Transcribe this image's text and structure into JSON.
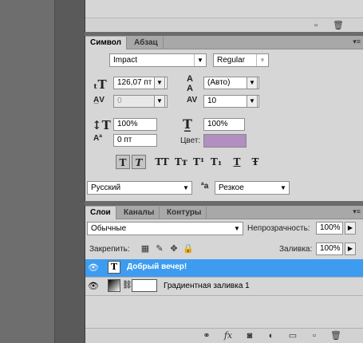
{
  "char_panel": {
    "tabs": [
      "Символ",
      "Абзац"
    ],
    "font_family": "Impact",
    "font_style": "Regular",
    "font_size": "126,07 пт",
    "leading": "(Авто)",
    "kerning": "0",
    "tracking": "10",
    "vertical_scale": "100%",
    "horizontal_scale": "100%",
    "baseline_shift": "0 пт",
    "color_label": "Цвет:",
    "color_value": "#b18fc0",
    "style_buttons": [
      "T",
      "T",
      "TT",
      "Tт",
      "T¹",
      "T₁",
      "T",
      "Ŧ"
    ],
    "language": "Русский",
    "antialias": "Резкое"
  },
  "layers_panel": {
    "tabs": [
      "Слои",
      "Каналы",
      "Контуры"
    ],
    "blend_mode": "Обычные",
    "opacity_label": "Непрозрачность:",
    "opacity_value": "100%",
    "lock_label": "Закрепить:",
    "fill_label": "Заливка:",
    "fill_value": "100%",
    "layers": [
      {
        "name": "Добрый вечер!",
        "type": "text",
        "selected": true
      },
      {
        "name": "Градиентная заливка 1",
        "type": "gradient",
        "selected": false
      }
    ]
  },
  "colors": {
    "selection": "#3e9cf0",
    "panel_bg": "#d6d6d6"
  }
}
